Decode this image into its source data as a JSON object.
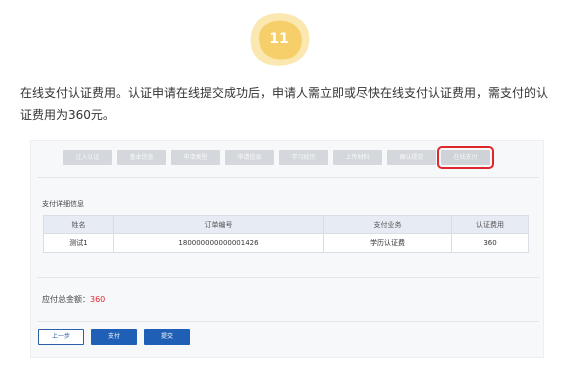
{
  "step_badge": {
    "number": "11",
    "color": "#f6cf6a"
  },
  "instruction": "在线支付认证费用。认证申请在线提交成功后，申请人需立即或尽快在线支付认证费用，需支付的认证费用为360元。",
  "wizard": {
    "steps": [
      "注入认证",
      "基本信息",
      "申请类型",
      "申请信息",
      "学习经历",
      "上传材料",
      "确认提交",
      "在线支付"
    ],
    "active_index": 7,
    "highlight_color": "#e0262d"
  },
  "payment_detail": {
    "title": "支付详细信息",
    "columns": [
      "姓名",
      "订单编号",
      "支付业务",
      "认证费用"
    ],
    "rows": [
      [
        "测试1",
        "180000000000001426",
        "学历认证费",
        "360"
      ]
    ]
  },
  "total": {
    "label": "应付总金额：",
    "amount": "360"
  },
  "buttons": {
    "prev": "上一步",
    "pay": "支付",
    "submit": "提交"
  }
}
